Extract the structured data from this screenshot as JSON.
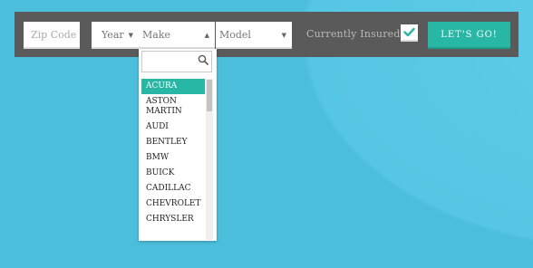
{
  "form": {
    "zip_placeholder": "Zip Code",
    "year_label": "Year",
    "make_label": "Make",
    "model_label": "Model",
    "insured_label": "Currently Insured?",
    "insured_checked": true,
    "go_label": "LET'S GO!"
  },
  "make_dropdown": {
    "search_value": "",
    "selected": "ACURA",
    "options": [
      "ACURA",
      "ASTON MARTIN",
      "AUDI",
      "BENTLEY",
      "BMW",
      "BUICK",
      "CADILLAC",
      "CHEVROLET",
      "CHRYSLER"
    ]
  },
  "colors": {
    "background": "#4fc1df",
    "bar": "#5a5a5a",
    "accent": "#27b7a4"
  },
  "icons": [
    "caret-down-icon",
    "caret-up-icon",
    "check-icon",
    "search-icon"
  ]
}
